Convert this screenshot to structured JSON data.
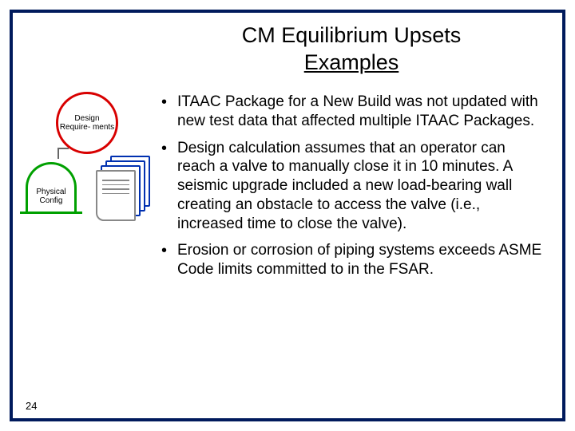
{
  "title": {
    "line1": "CM Equilibrium Upsets",
    "line2": "Examples"
  },
  "diagram": {
    "design_label": "Design Require- ments",
    "physical_label": "Physical Config"
  },
  "bullets": [
    "ITAAC Package for a New Build was not updated with new test data that affected multiple ITAAC Packages.",
    "Design calculation assumes that an operator can reach a valve to manually close it in 10 minutes. A seismic upgrade included a new load-bearing wall creating an obstacle to access the valve (i.e., increased time to close the valve).",
    "Erosion or corrosion of piping systems exceeds ASME Code limits committed to in the FSAR."
  ],
  "page_number": "24"
}
